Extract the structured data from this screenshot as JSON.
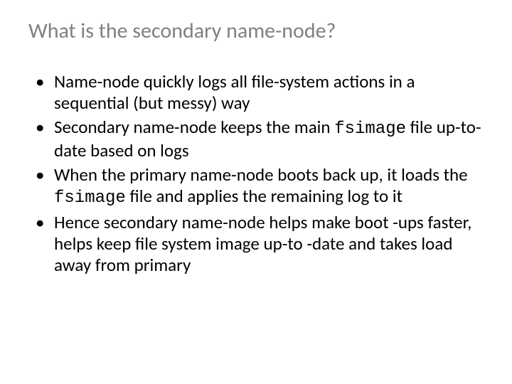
{
  "slide": {
    "title": "What is the secondary name-node?",
    "bullets": [
      {
        "pre": "Name-node quickly logs all file-system actions in a sequential (but messy) way"
      },
      {
        "pre": "Secondary name-node keeps the main ",
        "code": "fsimage",
        "post": " file up-to-date based on logs"
      },
      {
        "pre": "When the primary name-node boots back up, it loads the ",
        "code": "fsimage",
        "post": " file and applies the remaining log to it"
      },
      {
        "pre": "Hence secondary name-node helps make boot -ups faster, helps keep file system image up-to -date and takes load away from primary"
      }
    ]
  }
}
